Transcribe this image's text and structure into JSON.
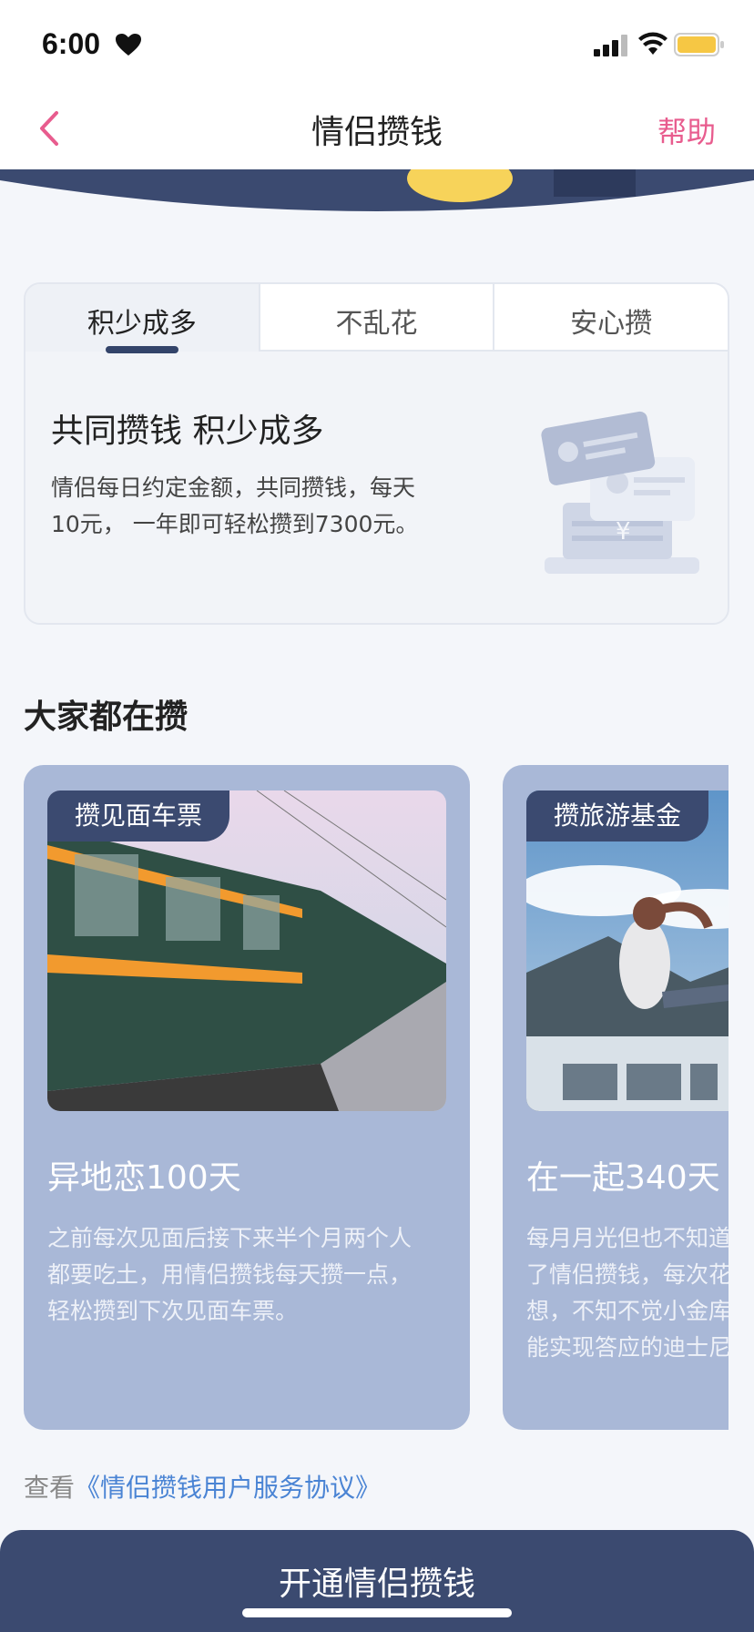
{
  "status_bar": {
    "time": "6:00",
    "icons": [
      "heart-icon",
      "signal-icon",
      "wifi-icon",
      "battery-icon"
    ],
    "battery_color": "#f6c744"
  },
  "nav": {
    "title": "情侣攒钱",
    "help_label": "帮助",
    "back_icon": "chevron-left-icon",
    "accent_color": "#e85c8e"
  },
  "feature": {
    "tabs": [
      {
        "label": "积少成多",
        "active": true
      },
      {
        "label": "不乱花",
        "active": false
      },
      {
        "label": "安心攒",
        "active": false
      }
    ],
    "title": "共同攒钱 积少成多",
    "description": "情侣每日约定金额，共同攒钱，每天10元， 一年即可轻松攒到7300元。",
    "illustration": "wallet-illustration"
  },
  "section": {
    "title": "大家都在攒"
  },
  "stories": [
    {
      "tag": "攒见面车票",
      "title": "异地恋100天",
      "body": "之前每次见面后接下来半个月两个人都要吃土，用情侣攒钱每天攒一点，轻松攒到下次见面车票。",
      "photo": "train-photo"
    },
    {
      "tag": "攒旅游基金",
      "title": "在一起340天",
      "body": "每月月光但也不知道钱花哪去了，用了情侣攒钱，每次花钱前都会想一想，不知不觉小金库就变大了，终于能实现答应的迪士尼旅游约定。",
      "photo": "travel-photo"
    }
  ],
  "agreement": {
    "prefix": "查看",
    "link": "《情侣攒钱用户服务协议》"
  },
  "cta": {
    "label": "开通情侣攒钱"
  },
  "colors": {
    "navy": "#3b4a70",
    "card_blue": "#a9b8d7",
    "link_blue": "#4a84d4"
  }
}
